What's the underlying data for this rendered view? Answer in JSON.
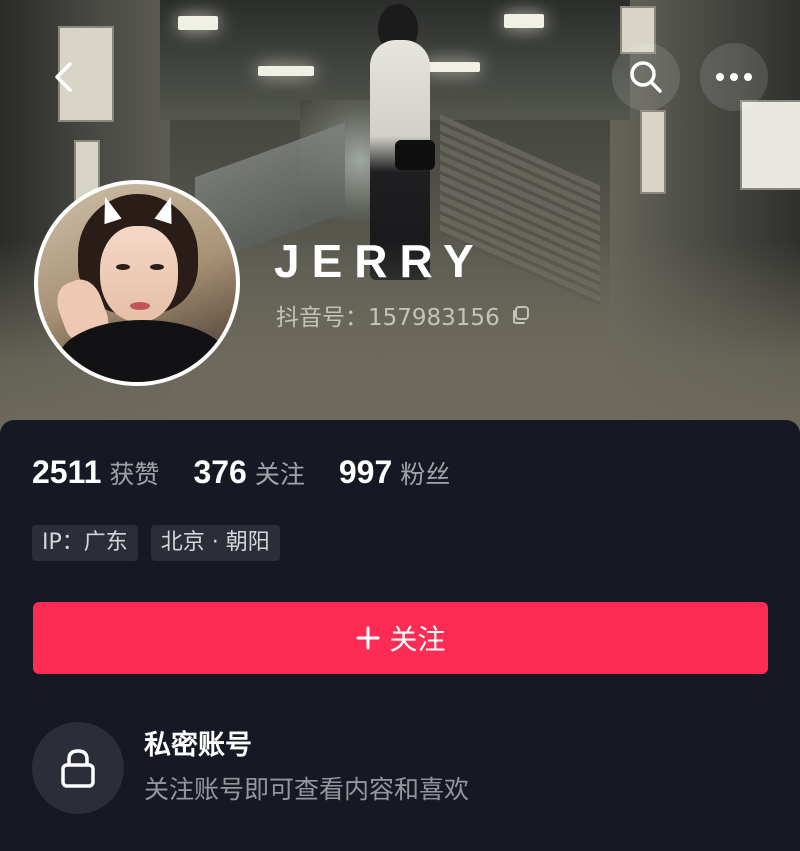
{
  "header": {
    "back_icon": "chevron-left-icon",
    "search_icon": "search-icon",
    "more_icon": "more-horizontal-icon"
  },
  "profile": {
    "username": "JERRY",
    "douyin_id_label": "抖音号：",
    "douyin_id": "157983156",
    "copy_icon": "copy-icon"
  },
  "stats": [
    {
      "value": "2511",
      "label": "获赞"
    },
    {
      "value": "376",
      "label": "关注"
    },
    {
      "value": "997",
      "label": "粉丝"
    }
  ],
  "tags": [
    {
      "text": "IP：广东"
    },
    {
      "text": "北京 · 朝阳"
    }
  ],
  "follow_button": {
    "icon": "plus-icon",
    "label": "关注"
  },
  "private_account": {
    "icon": "lock-icon",
    "title": "私密账号",
    "subtitle": "关注账号即可查看内容和喜欢"
  },
  "colors": {
    "accent": "#fe2c55",
    "background": "#161823",
    "chip": "#2b2d38"
  }
}
